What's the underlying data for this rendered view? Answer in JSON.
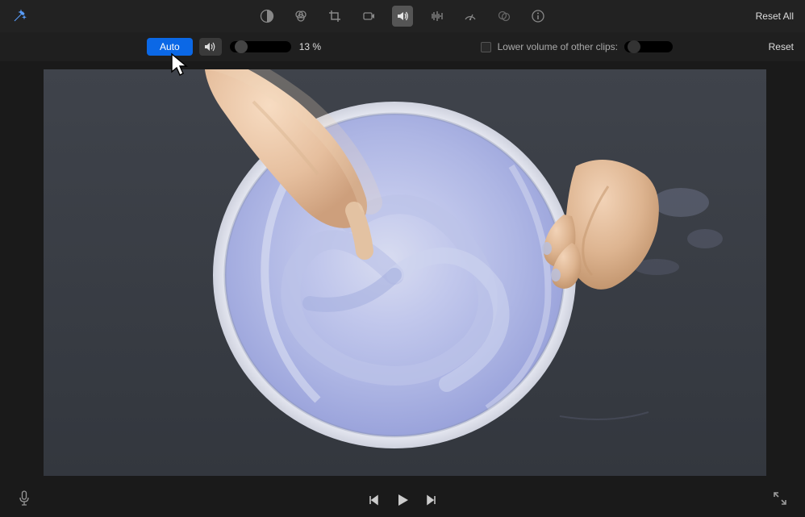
{
  "topbar": {
    "reset_all": "Reset All"
  },
  "audio": {
    "auto_label": "Auto",
    "volume_pct": "13",
    "volume_suffix": " %",
    "lower_label": "Lower volume of other clips:",
    "reset": "Reset"
  }
}
